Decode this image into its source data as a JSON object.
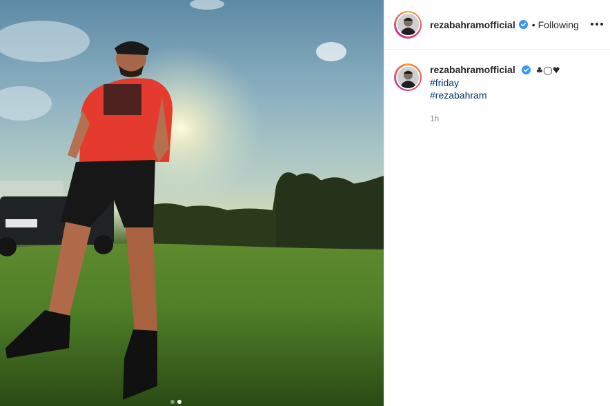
{
  "post": {
    "username": "rezabahramofficial",
    "separator": "•",
    "follow_state": "Following",
    "caption_emoji": "♣◯♥",
    "hashtags": [
      "#friday",
      "#rezabahram"
    ],
    "time_ago": "1h",
    "carousel": {
      "count": 2,
      "active_index": 1
    }
  },
  "icons": {
    "verified": "verified-badge-icon",
    "more": "more-options-icon"
  },
  "colors": {
    "verified_blue": "#3897f0",
    "hashtag": "#00376b",
    "timestamp": "#8e8e8e"
  }
}
